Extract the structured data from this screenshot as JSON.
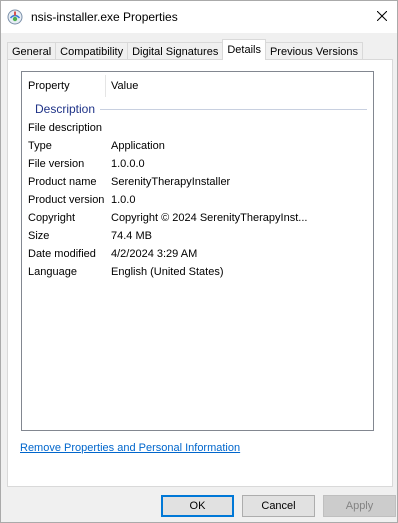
{
  "window": {
    "title": "nsis-installer.exe Properties",
    "icon": "installer-app-icon",
    "close_icon": "close-icon"
  },
  "tabs": [
    {
      "label": "General",
      "active": false
    },
    {
      "label": "Compatibility",
      "active": false
    },
    {
      "label": "Digital Signatures",
      "active": false
    },
    {
      "label": "Details",
      "active": true
    },
    {
      "label": "Previous Versions",
      "active": false
    }
  ],
  "details": {
    "columns": {
      "property": "Property",
      "value": "Value"
    },
    "group_label": "Description",
    "rows": [
      {
        "property": "File description",
        "value": ""
      },
      {
        "property": "Type",
        "value": "Application"
      },
      {
        "property": "File version",
        "value": "1.0.0.0"
      },
      {
        "property": "Product name",
        "value": "SerenityTherapyInstaller"
      },
      {
        "property": "Product version",
        "value": "1.0.0"
      },
      {
        "property": "Copyright",
        "value": "Copyright © 2024 SerenityTherapyInst..."
      },
      {
        "property": "Size",
        "value": "74.4 MB"
      },
      {
        "property": "Date modified",
        "value": "4/2/2024 3:29 AM"
      },
      {
        "property": "Language",
        "value": "English (United States)"
      }
    ],
    "remove_link": "Remove Properties and Personal Information"
  },
  "buttons": {
    "ok": "OK",
    "cancel": "Cancel",
    "apply": "Apply"
  },
  "colors": {
    "accent": "#0078d7",
    "link": "#0066cc",
    "group_header": "#1e3287"
  }
}
